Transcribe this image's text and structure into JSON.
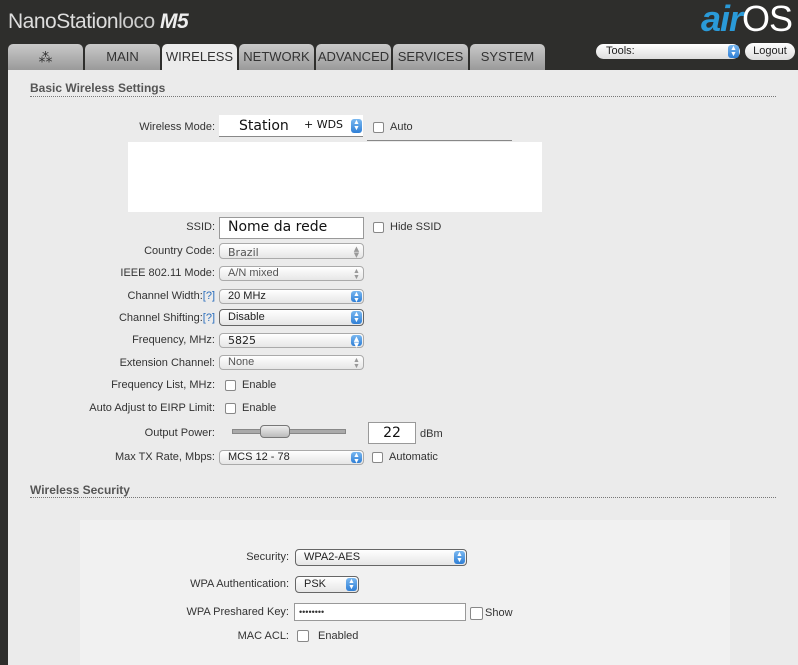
{
  "header": {
    "brand": "NanoStation",
    "brand_model": "loco",
    "brand_suffix": "M5",
    "logo_air": "air",
    "logo_os": "OS",
    "tabs": [
      {
        "label": "MAIN"
      },
      {
        "label": "WIRELESS"
      },
      {
        "label": "NETWORK"
      },
      {
        "label": "ADVANCED"
      },
      {
        "label": "SERVICES"
      },
      {
        "label": "SYSTEM"
      }
    ],
    "tools_label": "Tools:",
    "logout_label": "Logout"
  },
  "basic": {
    "title": "Basic Wireless Settings",
    "wireless_mode": {
      "label": "Wireless Mode:",
      "value": "Station",
      "suffix": "+ WDS",
      "auto": "Auto"
    },
    "ssid": {
      "label": "SSID:",
      "value": "Nome da rede",
      "hide": "Hide SSID"
    },
    "country": {
      "label": "Country Code:",
      "value": "Brazil"
    },
    "ieee": {
      "label": "IEEE 802.11 Mode:",
      "value": "A/N mixed"
    },
    "width": {
      "label": "Channel Width:",
      "help": "[?]",
      "value": "20 MHz"
    },
    "shift": {
      "label": "Channel Shifting:",
      "help": "[?]",
      "value": "Disable"
    },
    "freq": {
      "label": "Frequency, MHz:",
      "value": "5825"
    },
    "ext": {
      "label": "Extension Channel:",
      "value": "None"
    },
    "freqlist": {
      "label": "Frequency List, MHz:",
      "option": "Enable"
    },
    "eirp": {
      "label": "Auto Adjust to EIRP Limit:",
      "option": "Enable"
    },
    "power": {
      "label": "Output Power:",
      "value": "22",
      "unit": "dBm",
      "slider_fraction": 0.33
    },
    "txrate": {
      "label": "Max TX Rate, Mbps:",
      "value": "MCS 12 - 78",
      "auto": "Automatic"
    }
  },
  "security": {
    "title": "Wireless Security",
    "security": {
      "label": "Security:",
      "value": "WPA2-AES"
    },
    "auth": {
      "label": "WPA Authentication:",
      "value": "PSK"
    },
    "key": {
      "label": "WPA Preshared Key:",
      "value": "••••••••",
      "show": "Show"
    },
    "mac": {
      "label": "MAC ACL:",
      "option": "Enabled"
    }
  }
}
